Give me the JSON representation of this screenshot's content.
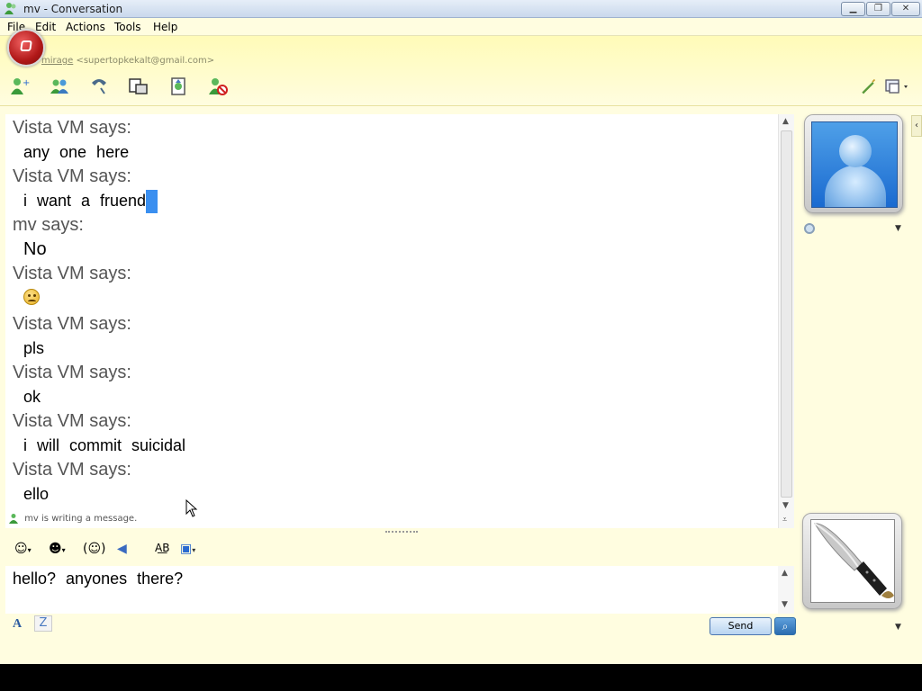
{
  "window": {
    "title": "mv - Conversation"
  },
  "menu": [
    "File",
    "Edit",
    "Actions",
    "Tools",
    "Help"
  ],
  "contact": {
    "name": "mirage",
    "email": "<supertopkekalt@gmail.com>"
  },
  "toolbar": {
    "icons": [
      "invite-contact-icon",
      "share-files-icon",
      "call-icon",
      "video-call-icon",
      "activities-icon",
      "block-contact-icon",
      "pen-icon",
      "display-options-icon"
    ]
  },
  "messages": [
    {
      "sender": "Vista VM says:",
      "text": "any one here"
    },
    {
      "sender": "Vista VM says:",
      "text": "i want a fruend"
    },
    {
      "sender": "mv says:",
      "text": "No"
    },
    {
      "sender": "Vista VM says:",
      "text": "",
      "emoticon": "sad-emoticon"
    },
    {
      "sender": "Vista VM says:",
      "text": "pls"
    },
    {
      "sender": "Vista VM says:",
      "text": "ok"
    },
    {
      "sender": "Vista VM says:",
      "text": "i will commit suicidal"
    },
    {
      "sender": "Vista VM says:",
      "text": "ello"
    }
  ],
  "status": {
    "typing": "mv is writing a message."
  },
  "compose": {
    "text": "hello? anyones there?",
    "send_label": "Send"
  },
  "format_toolbar": {
    "icons": [
      "emoticon-icon",
      "wink-icon",
      "nudge-icon",
      "voice-clip-icon",
      "spelling-icon",
      "background-icon"
    ]
  }
}
